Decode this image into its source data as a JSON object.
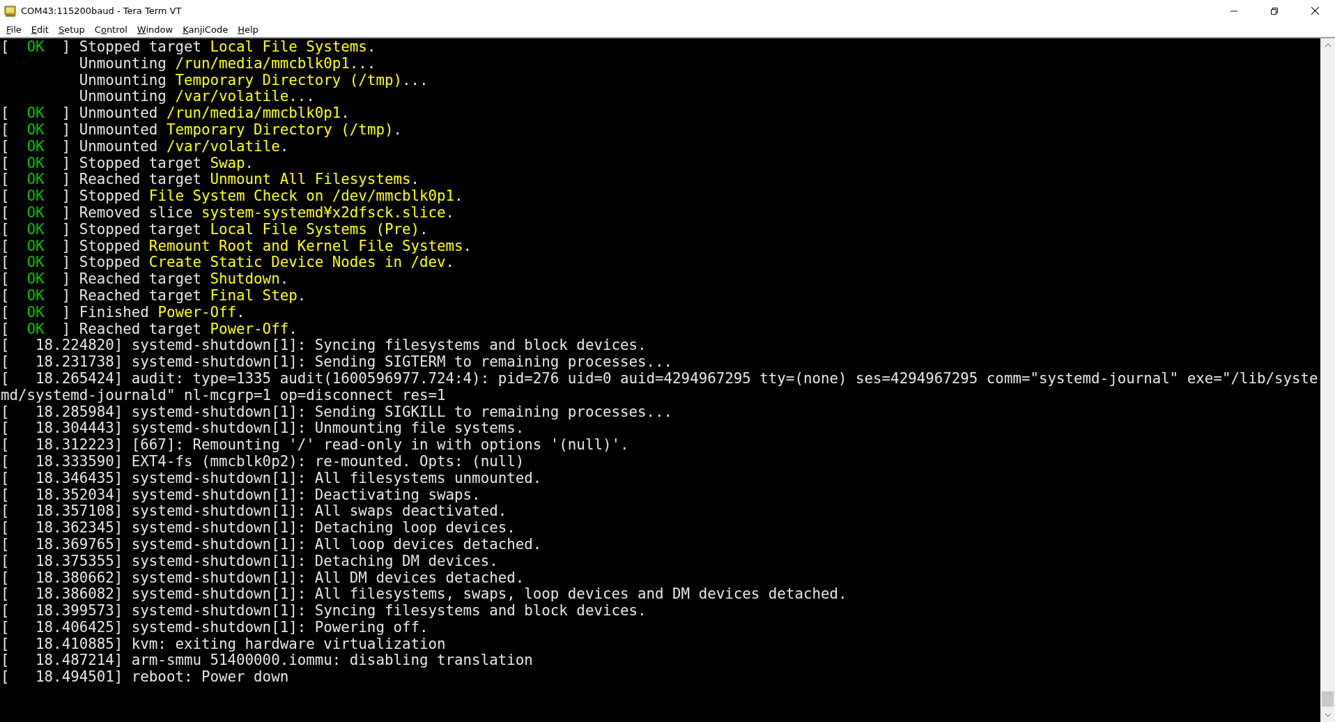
{
  "window": {
    "title": "COM43:115200baud - Tera Term VT"
  },
  "menu": [
    {
      "key": "F",
      "after": "ile"
    },
    {
      "key": "E",
      "after": "dit"
    },
    {
      "key": "S",
      "after": "etup"
    },
    {
      "before": "C",
      "key": "o",
      "after": "ntrol"
    },
    {
      "key": "W",
      "after": "indow"
    },
    {
      "key": "K",
      "after": "anjiCode"
    },
    {
      "key": "H",
      "after": "elp"
    }
  ],
  "lines": [
    {
      "kind": "status",
      "open": "[",
      "status": "OK",
      "close": "]",
      "prefix": "Stopped target ",
      "target": "Local File Systems",
      "suffix": "."
    },
    {
      "kind": "pending",
      "prefix": "Unmounting ",
      "target": "/run/media/mmcblk0p1",
      "suffix": "..."
    },
    {
      "kind": "pending",
      "prefix": "Unmounting ",
      "target": "Temporary Directory (/tmp)",
      "suffix": "..."
    },
    {
      "kind": "pending",
      "prefix": "Unmounting ",
      "target": "/var/volatile",
      "suffix": "..."
    },
    {
      "kind": "status",
      "open": "[",
      "status": "OK",
      "close": "]",
      "prefix": "Unmounted ",
      "target": "/run/media/mmcblk0p1",
      "suffix": "."
    },
    {
      "kind": "status",
      "open": "[",
      "status": "OK",
      "close": "]",
      "prefix": "Unmounted ",
      "target": "Temporary Directory (/tmp)",
      "suffix": "."
    },
    {
      "kind": "status",
      "open": "[",
      "status": "OK",
      "close": "]",
      "prefix": "Unmounted ",
      "target": "/var/volatile",
      "suffix": "."
    },
    {
      "kind": "status",
      "open": "[",
      "status": "OK",
      "close": "]",
      "prefix": "Stopped target ",
      "target": "Swap",
      "suffix": "."
    },
    {
      "kind": "status",
      "open": "[",
      "status": "OK",
      "close": "]",
      "prefix": "Reached target ",
      "target": "Unmount All Filesystems",
      "suffix": "."
    },
    {
      "kind": "status",
      "open": "[",
      "status": "OK",
      "close": "]",
      "prefix": "Stopped ",
      "target": "File System Check on /dev/mmcblk0p1",
      "suffix": "."
    },
    {
      "kind": "status",
      "open": "[",
      "status": "OK",
      "close": "]",
      "prefix": "Removed slice ",
      "target": "system-systemd¥x2dfsck.slice",
      "suffix": "."
    },
    {
      "kind": "status",
      "open": "[",
      "status": "OK",
      "close": "]",
      "prefix": "Stopped target ",
      "target": "Local File Systems (Pre)",
      "suffix": "."
    },
    {
      "kind": "status",
      "open": "[",
      "status": "OK",
      "close": "]",
      "prefix": "Stopped ",
      "target": "Remount Root and Kernel File Systems",
      "suffix": "."
    },
    {
      "kind": "status",
      "open": "[",
      "status": "OK",
      "close": "]",
      "prefix": "Stopped ",
      "target": "Create Static Device Nodes in /dev",
      "suffix": "."
    },
    {
      "kind": "status",
      "open": "[",
      "status": "OK",
      "close": "]",
      "prefix": "Reached target ",
      "target": "Shutdown",
      "suffix": "."
    },
    {
      "kind": "status",
      "open": "[",
      "status": "OK",
      "close": "]",
      "prefix": "Reached target ",
      "target": "Final Step",
      "suffix": "."
    },
    {
      "kind": "status",
      "open": "[",
      "status": "OK",
      "close": "]",
      "prefix": "Finished ",
      "target": "Power-Off",
      "suffix": "."
    },
    {
      "kind": "status",
      "open": "[",
      "status": "OK",
      "close": "]",
      "prefix": "Reached target ",
      "target": "Power-Off",
      "suffix": "."
    },
    {
      "kind": "kernel",
      "text": "[   18.224820] systemd-shutdown[1]: Syncing filesystems and block devices."
    },
    {
      "kind": "kernel",
      "text": "[   18.231738] systemd-shutdown[1]: Sending SIGTERM to remaining processes..."
    },
    {
      "kind": "kernel",
      "text": "[   18.265424] audit: type=1335 audit(1600596977.724:4): pid=276 uid=0 auid=4294967295 tty=(none) ses=4294967295 comm=\"systemd-journal\" exe=\"/lib/systemd/systemd-journald\" nl-mcgrp=1 op=disconnect res=1"
    },
    {
      "kind": "kernel",
      "text": "[   18.285984] systemd-shutdown[1]: Sending SIGKILL to remaining processes..."
    },
    {
      "kind": "kernel",
      "text": "[   18.304443] systemd-shutdown[1]: Unmounting file systems."
    },
    {
      "kind": "kernel",
      "text": "[   18.312223] [667]: Remounting '/' read-only in with options '(null)'."
    },
    {
      "kind": "kernel",
      "text": "[   18.333590] EXT4-fs (mmcblk0p2): re-mounted. Opts: (null)"
    },
    {
      "kind": "kernel",
      "text": "[   18.346435] systemd-shutdown[1]: All filesystems unmounted."
    },
    {
      "kind": "kernel",
      "text": "[   18.352034] systemd-shutdown[1]: Deactivating swaps."
    },
    {
      "kind": "kernel",
      "text": "[   18.357108] systemd-shutdown[1]: All swaps deactivated."
    },
    {
      "kind": "kernel",
      "text": "[   18.362345] systemd-shutdown[1]: Detaching loop devices."
    },
    {
      "kind": "kernel",
      "text": "[   18.369765] systemd-shutdown[1]: All loop devices detached."
    },
    {
      "kind": "kernel",
      "text": "[   18.375355] systemd-shutdown[1]: Detaching DM devices."
    },
    {
      "kind": "kernel",
      "text": "[   18.380662] systemd-shutdown[1]: All DM devices detached."
    },
    {
      "kind": "kernel",
      "text": "[   18.386082] systemd-shutdown[1]: All filesystems, swaps, loop devices and DM devices detached."
    },
    {
      "kind": "kernel",
      "text": "[   18.399573] systemd-shutdown[1]: Syncing filesystems and block devices."
    },
    {
      "kind": "kernel",
      "text": "[   18.406425] systemd-shutdown[1]: Powering off."
    },
    {
      "kind": "kernel",
      "text": "[   18.410885] kvm: exiting hardware virtualization"
    },
    {
      "kind": "kernel",
      "text": "[   18.487214] arm-smmu 51400000.iommu: disabling translation"
    },
    {
      "kind": "kernel",
      "text": "[   18.494501] reboot: Power down"
    }
  ]
}
